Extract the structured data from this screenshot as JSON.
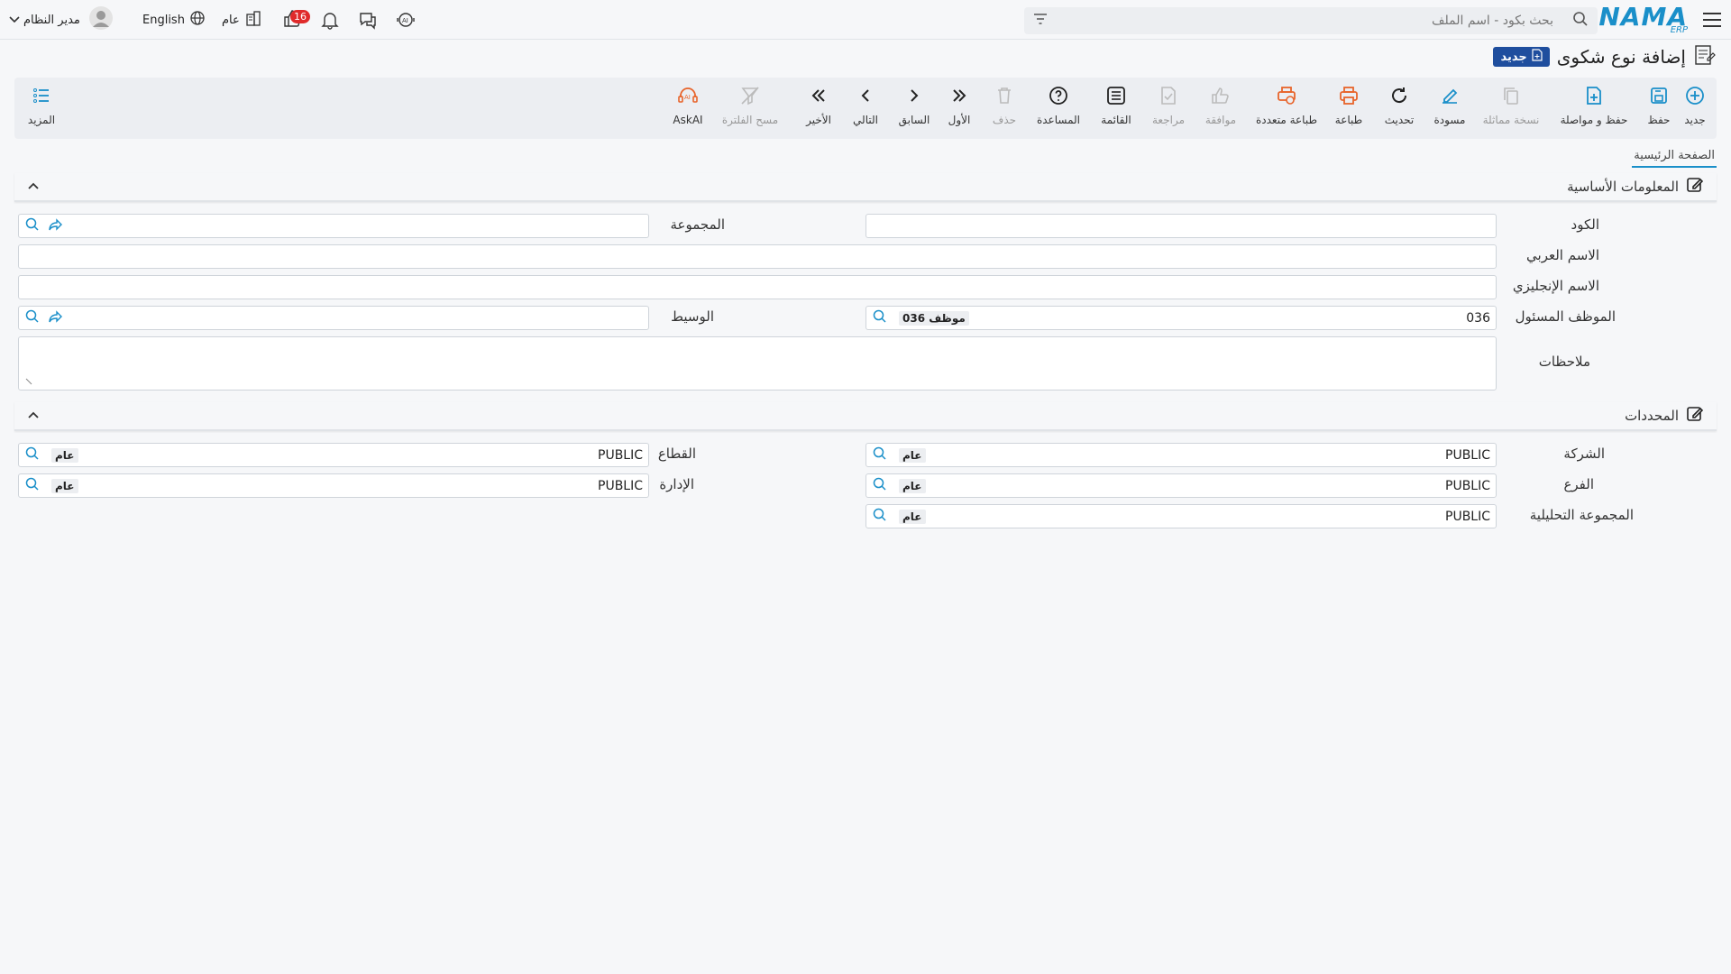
{
  "topbar": {
    "logo": "NAMA",
    "logo_sub": "ERP",
    "search_placeholder": "بحث بكود - اسم الملف",
    "notif_count": "16",
    "scope": "عام",
    "language": "English",
    "user": "مدير النظام"
  },
  "page": {
    "title": "إضافة نوع شكوى",
    "badge": "جديد"
  },
  "toolbar": {
    "new": "جديد",
    "save": "حفظ",
    "save_continue": "حفظ و مواصلة",
    "copy": "نسخة مماثلة",
    "draft": "مسودة",
    "refresh": "تحديث",
    "print": "طباعة",
    "multi_print": "طباعة متعددة",
    "approve": "موافقة",
    "review": "مراجعة",
    "list": "القائمة",
    "help": "المساعدة",
    "delete": "حذف",
    "first": "الأول",
    "prev": "السابق",
    "next": "التالي",
    "last": "الأخير",
    "clear_filter": "مسح الفلترة",
    "askai": "AskAI",
    "more": "المزيد"
  },
  "tabs": [
    "الصفحة الرئيسية"
  ],
  "basic": {
    "title": "المعلومات الأساسية",
    "code_label": "الكود",
    "group_label": "المجموعة",
    "arabic_label": "الاسم العربي",
    "english_label": "الاسم الإنجليزي",
    "employee_label": "الموظف المسئول",
    "employee_code": "036",
    "employee_name": "موظف 036",
    "broker_label": "الوسيط",
    "notes_label": "ملاحظات"
  },
  "dims": {
    "title": "المحددات",
    "company_label": "الشركة",
    "sector_label": "القطاع",
    "branch_label": "الفرع",
    "dept_label": "الإدارة",
    "analytic_label": "المجموعة التحليلية",
    "code": "PUBLIC",
    "name": "عام"
  }
}
